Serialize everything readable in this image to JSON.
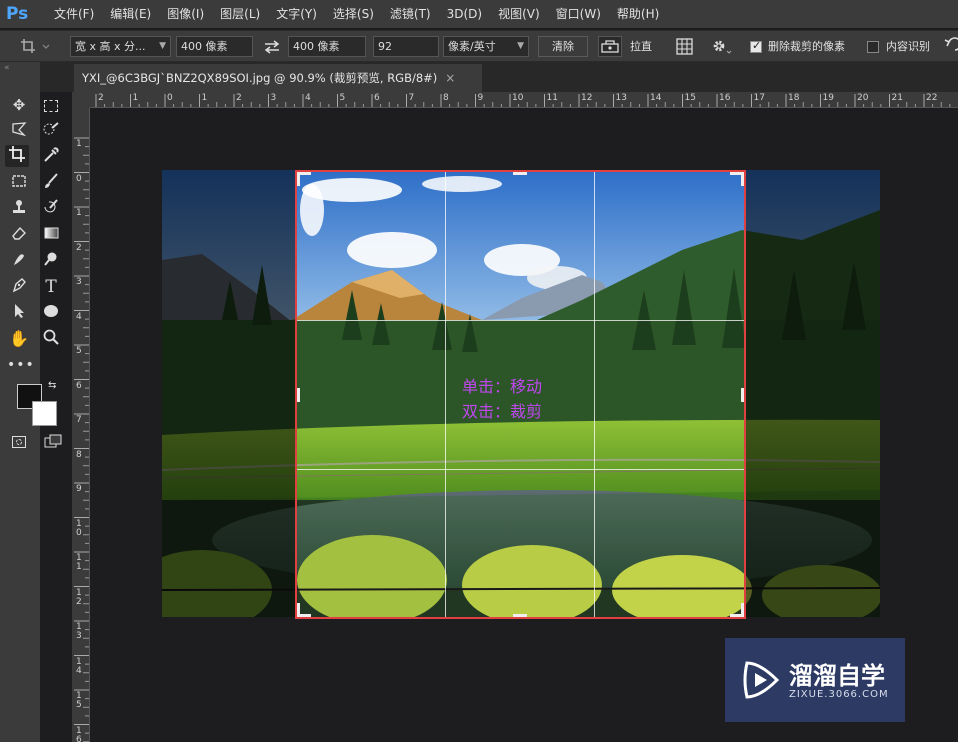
{
  "app": {
    "logo": "Ps",
    "menu": [
      "文件(F)",
      "编辑(E)",
      "图像(I)",
      "图层(L)",
      "文字(Y)",
      "选择(S)",
      "滤镜(T)",
      "3D(D)",
      "视图(V)",
      "窗口(W)",
      "帮助(H)"
    ]
  },
  "options": {
    "ratio_preset": "宽 x 高 x 分...",
    "width_value": "400 像素",
    "height_value": "400 像素",
    "resolution_value": "92",
    "resolution_unit": "像素/英寸",
    "clear_label": "清除",
    "straighten_label": "拉直",
    "delete_cropped_label": "删除裁剪的像素",
    "delete_cropped_checked": true,
    "content_aware_label": "内容识别",
    "content_aware_checked": false
  },
  "document": {
    "tab_title": "YXI_@6C3BGJ`BNZ2QX89SOI.jpg @ 90.9% (裁剪预览, RGB/8#)",
    "close_glyph": "×"
  },
  "rulers": {
    "h_labels": [
      "2",
      "1",
      "0",
      "1",
      "2",
      "3",
      "4",
      "5",
      "6",
      "7",
      "8",
      "9",
      "10",
      "11",
      "12",
      "13",
      "14",
      "15",
      "16",
      "17",
      "18",
      "19",
      "20",
      "21",
      "22"
    ],
    "v_labels": [
      "1",
      "0",
      "1",
      "2",
      "3",
      "4",
      "5",
      "6",
      "7",
      "8",
      "9",
      "10",
      "11",
      "12",
      "13",
      "14",
      "15",
      "16"
    ]
  },
  "canvas": {
    "hint_line1": "单击：移动",
    "hint_line2": "双击：裁剪"
  },
  "watermark": {
    "title": "溜溜自学",
    "url": "ZIXUE.3066.COM"
  },
  "colors": {
    "crop_border": "#e04040",
    "hint_text": "#c046f0",
    "ps_blue": "#4ea6ff",
    "watermark_bg": "#2c3a64"
  },
  "tools": [
    "move-tool",
    "marquee-tool",
    "lasso-tool",
    "quick-select-tool",
    "crop-tool",
    "eyedropper-tool",
    "frame-tool",
    "brush-tool",
    "stamp-tool",
    "history-brush-tool",
    "eraser-tool",
    "gradient-tool",
    "smudge-tool",
    "dodge-tool",
    "pen-tool",
    "type-tool",
    "path-select-tool",
    "ellipse-tool",
    "hand-tool",
    "zoom-tool",
    "more-tools",
    "foreground-color",
    "background-color",
    "quick-mask",
    "screen-mode"
  ]
}
